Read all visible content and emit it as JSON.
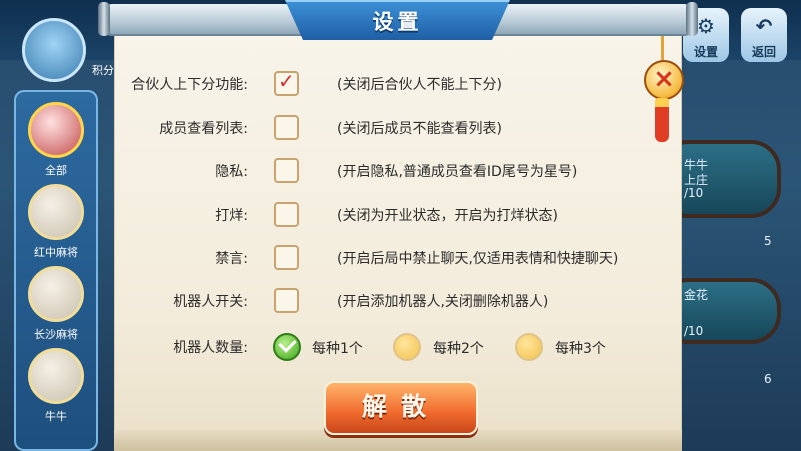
{
  "dialog": {
    "title": "设置",
    "close_glyph": "×",
    "rows": [
      {
        "label": "合伙人上下分功能:",
        "checked": true,
        "desc": "(关闭后合伙人不能上下分)"
      },
      {
        "label": "成员查看列表:",
        "checked": false,
        "desc": "(关闭后成员不能查看列表)"
      },
      {
        "label": "隐私:",
        "checked": false,
        "desc": "(开启隐私,普通成员查看ID尾号为星号)"
      },
      {
        "label": "打烊:",
        "checked": false,
        "desc": "(关闭为开业状态，开启为打烊状态)"
      },
      {
        "label": "禁言:",
        "checked": false,
        "desc": "(开启后局中禁止聊天,仅适用表情和快捷聊天)"
      },
      {
        "label": "机器人开关:",
        "checked": false,
        "desc": "(开启添加机器人,关闭删除机器人)"
      }
    ],
    "robot_count": {
      "label": "机器人数量:",
      "options": [
        "每种1个",
        "每种2个",
        "每种3个"
      ],
      "selected_index": 0
    },
    "dissolve_button": "解散",
    "check_mark": "✓"
  },
  "background": {
    "top_right_buttons": [
      {
        "label": "设置",
        "glyph": "⚙"
      },
      {
        "label": "返回",
        "glyph": "↶"
      }
    ],
    "left_rail": [
      "全部",
      "红中麻将",
      "长沙麻将",
      "牛牛"
    ],
    "left_partial": "积分",
    "table_texts": [
      "牛牛",
      "上庄",
      "/10",
      "5",
      "金花",
      "/10",
      "6"
    ]
  }
}
